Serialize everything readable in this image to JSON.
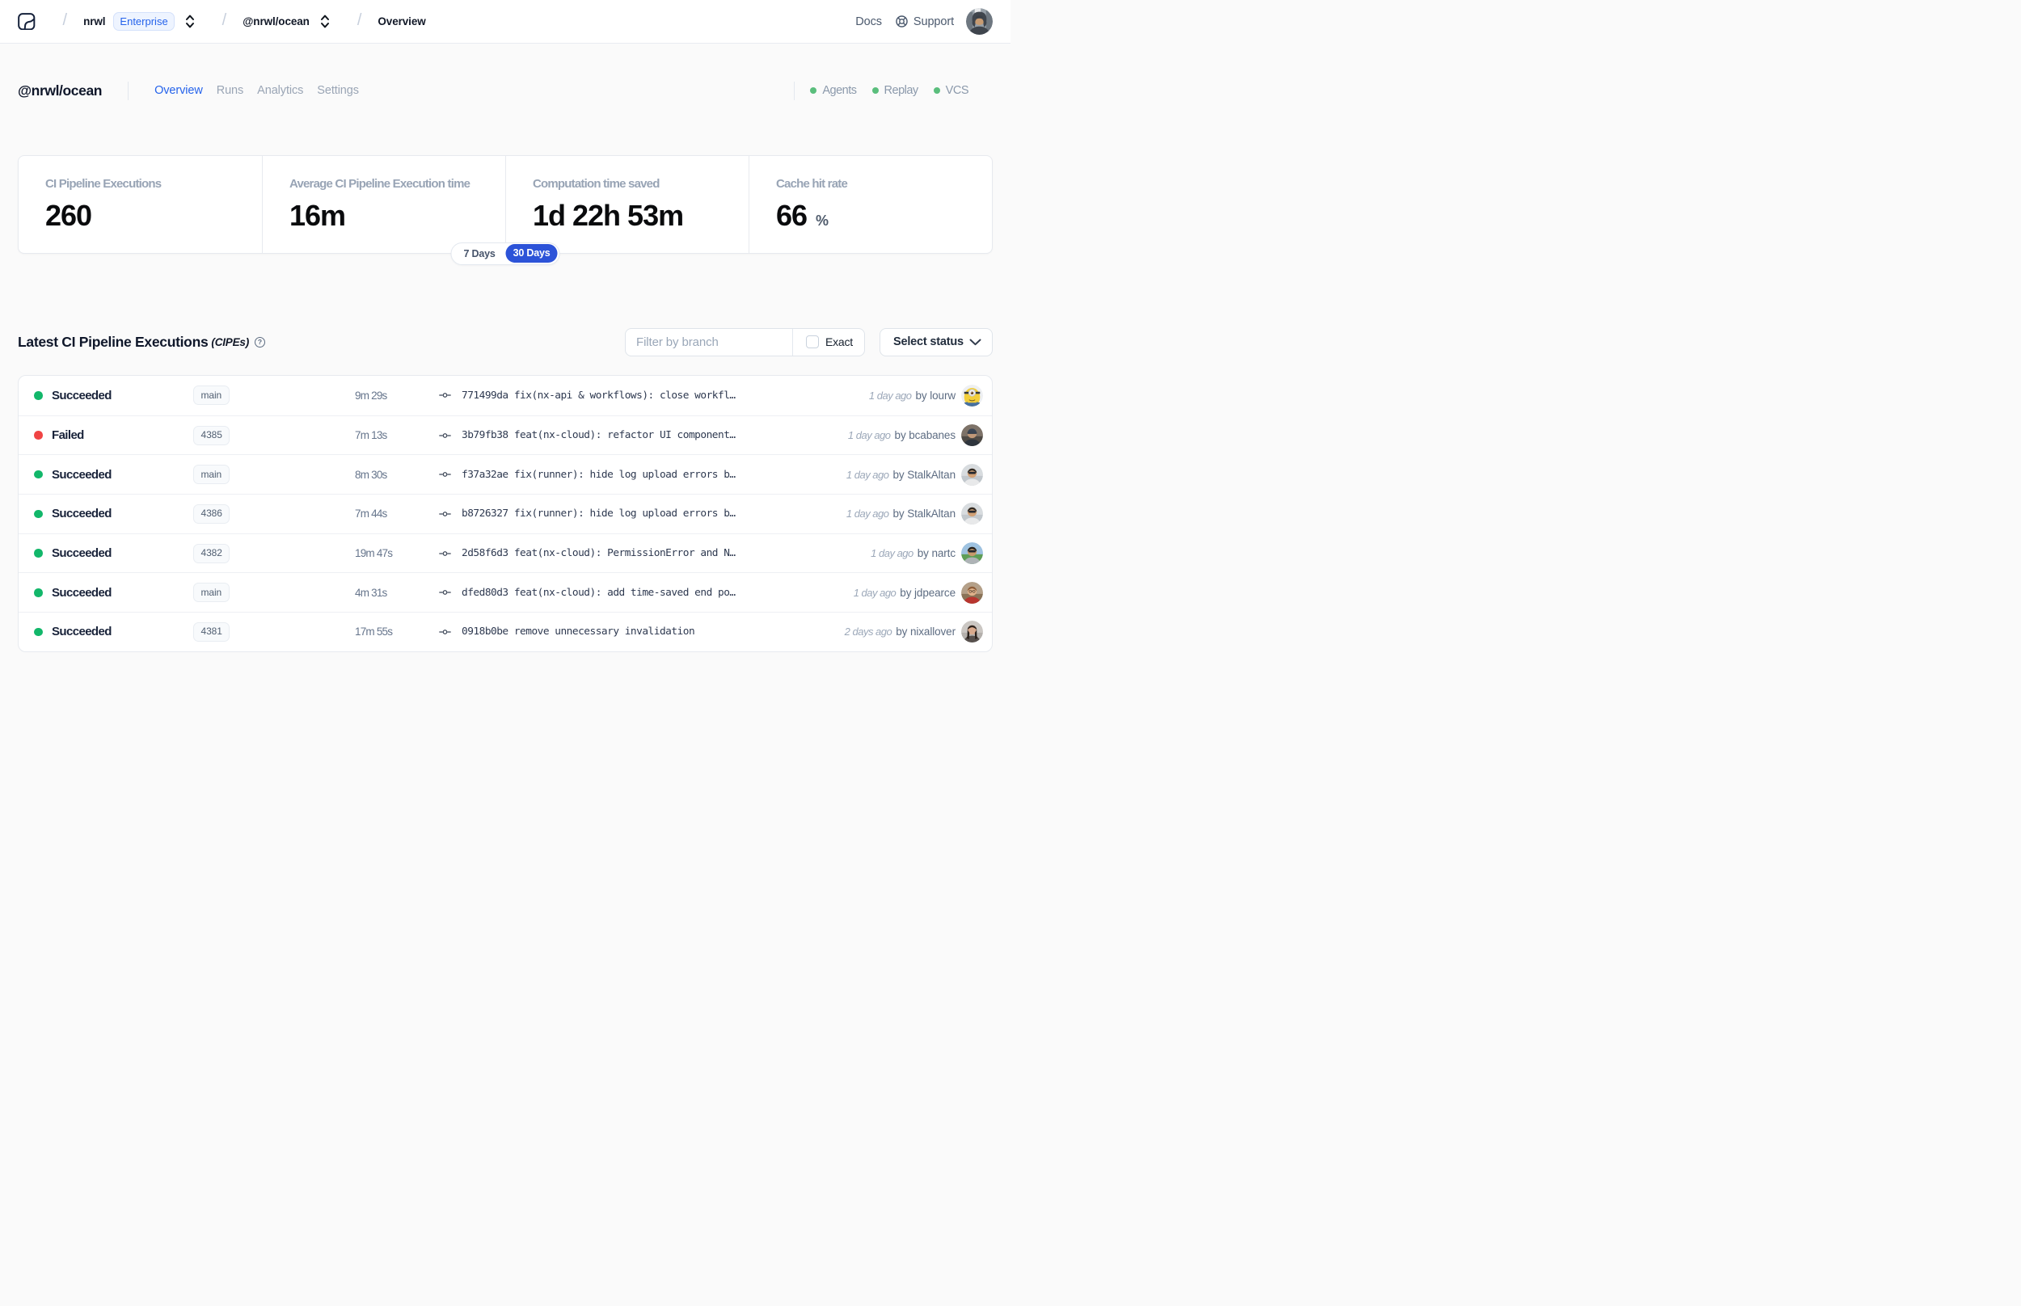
{
  "header": {
    "org": "nrwl",
    "org_badge": "Enterprise",
    "workspace": "@nrwl/ocean",
    "page": "Overview",
    "docs_label": "Docs",
    "support_label": "Support",
    "user_avatar": {
      "kind": "person",
      "bg": "#97a0a8",
      "bg2": "#6e7780",
      "skin": "#c79b72",
      "hair": "#3a3f46",
      "top": "#3f454d",
      "accessory": "hood",
      "scene": "city"
    }
  },
  "toolbar": {
    "workspace_title": "@nrwl/ocean",
    "tabs": [
      {
        "label": "Overview",
        "active": true
      },
      {
        "label": "Runs",
        "active": false
      },
      {
        "label": "Analytics",
        "active": false
      },
      {
        "label": "Settings",
        "active": false
      }
    ],
    "env_statuses": [
      {
        "label": "Agents",
        "state_color": "#5abe7c"
      },
      {
        "label": "Replay",
        "state_color": "#5abe7c"
      },
      {
        "label": "VCS",
        "state_color": "#5abe7c"
      }
    ]
  },
  "stats": {
    "cards": [
      {
        "label": "CI Pipeline Executions",
        "value": "260",
        "suffix": ""
      },
      {
        "label": "Average CI Pipeline Execution time",
        "value": "16m",
        "suffix": ""
      },
      {
        "label": "Computation time saved",
        "value": "1d 22h 53m",
        "suffix": ""
      },
      {
        "label": "Cache hit rate",
        "value": "66",
        "suffix": "%"
      }
    ],
    "range_toggle": {
      "options": [
        {
          "label": "7 Days",
          "active": false
        },
        {
          "label": "30 Days",
          "active": true
        }
      ]
    }
  },
  "list": {
    "title": "Latest CI Pipeline Executions",
    "title_suffix": "(CIPEs)",
    "help_glyph": "?",
    "filter": {
      "branch_placeholder": "Filter by branch",
      "exact_label": "Exact",
      "status_label": "Select status"
    },
    "rows": [
      {
        "status": "Succeeded",
        "state": "succeeded",
        "branch": "main",
        "duration": "9m 29s",
        "commit": "771499da fix(nx-api & workflows): close workfl…",
        "time_ago": "1 day ago",
        "author": "by lourw",
        "avatar": {
          "kind": "minion",
          "bg": "#eef0f2"
        }
      },
      {
        "status": "Failed",
        "state": "failed",
        "branch": "4385",
        "duration": "7m 13s",
        "commit": "3b79fb38 feat(nx-cloud): refactor UI component…",
        "time_ago": "1 day ago",
        "author": "by bcabanes",
        "avatar": {
          "kind": "person",
          "bg": "#7d7268",
          "bg2": "#4e4a45",
          "skin": "#c09878",
          "hair": "#23282e",
          "top": "#2e353d",
          "accessory": "beanie",
          "beanie": "#3c4654"
        }
      },
      {
        "status": "Succeeded",
        "state": "succeeded",
        "branch": "main",
        "duration": "8m 30s",
        "commit": "f37a32ae fix(runner): hide log upload errors b…",
        "time_ago": "1 day ago",
        "author": "by StalkAltan",
        "avatar": {
          "kind": "person",
          "bg": "#d8dcdf",
          "bg2": "#c2c8cd",
          "skin": "#d2a176",
          "hair": "#2c2722",
          "top": "#e8e9ea",
          "accessory": "sunglasses"
        }
      },
      {
        "status": "Succeeded",
        "state": "succeeded",
        "branch": "4386",
        "duration": "7m 44s",
        "commit": "b8726327 fix(runner): hide log upload errors b…",
        "time_ago": "1 day ago",
        "author": "by StalkAltan",
        "avatar": {
          "kind": "person",
          "bg": "#d8dcdf",
          "bg2": "#c2c8cd",
          "skin": "#d2a176",
          "hair": "#2c2722",
          "top": "#e8e9ea",
          "accessory": "sunglasses"
        }
      },
      {
        "status": "Succeeded",
        "state": "succeeded",
        "branch": "4382",
        "duration": "19m 47s",
        "commit": "2d58f6d3 feat(nx-cloud): PermissionError and N…",
        "time_ago": "1 day ago",
        "author": "by nartc",
        "avatar": {
          "kind": "person",
          "bg": "#9ec2e0",
          "bg2": "#5f9e57",
          "skin": "#c89a6c",
          "hair": "#1d1c1a",
          "top": "#aeb3b6",
          "accessory": "sunglasses"
        }
      },
      {
        "status": "Succeeded",
        "state": "succeeded",
        "branch": "main",
        "duration": "4m 31s",
        "commit": "dfed80d3 feat(nx-cloud): add time-saved end po…",
        "time_ago": "1 day ago",
        "author": "by jdpearce",
        "avatar": {
          "kind": "person",
          "bg": "#b4a089",
          "bg2": "#8a7358",
          "skin": "#dfb18a",
          "hair": "#8a5a36",
          "top": "#b8352f",
          "accessory": "glasses"
        }
      },
      {
        "status": "Succeeded",
        "state": "succeeded",
        "branch": "4381",
        "duration": "17m 55s",
        "commit": "0918b0be remove unnecessary invalidation",
        "time_ago": "2 days ago",
        "author": "by nixallover",
        "avatar": {
          "kind": "person",
          "bg": "#cbc7c3",
          "bg2": "#b4b0ac",
          "skin": "#d8a98c",
          "hair": "#2a211c",
          "top": "#57504d",
          "accessory": "longhair"
        }
      }
    ]
  },
  "colors": {
    "accent_blue": "#2563eb",
    "toggle_active_blue": "#2c53d8",
    "success_green": "#12b76a",
    "fail_red": "#ef4444",
    "env_green": "#5abe7c"
  }
}
